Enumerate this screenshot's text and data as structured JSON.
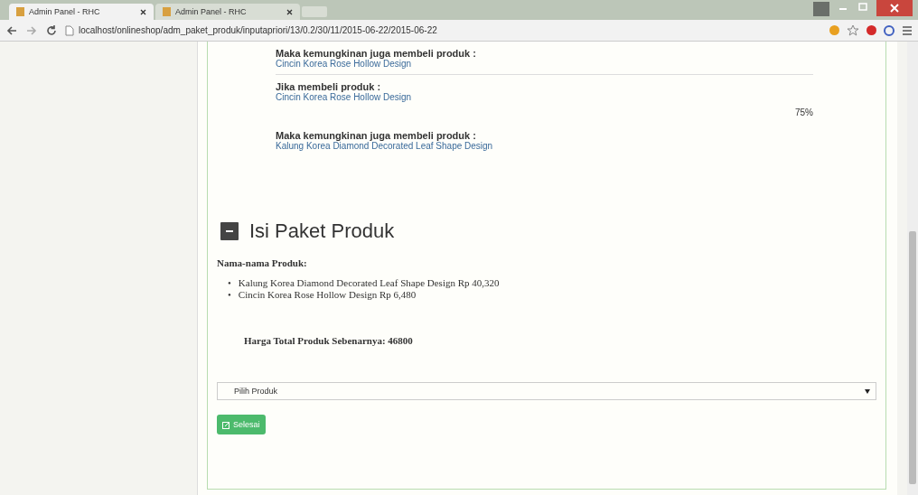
{
  "browser": {
    "tabs": [
      {
        "title": "Admin Panel - RHC",
        "selected": true
      },
      {
        "title": "Admin Panel - RHC",
        "selected": false
      }
    ],
    "url": "localhost/onlineshop/adm_paket_produk/inputapriori/13/0.2/30/11/2015-06-22/2015-06-22"
  },
  "rules": [
    {
      "items": [
        {
          "kind": "label",
          "text": "Maka kemungkinan juga membeli produk :"
        },
        {
          "kind": "product",
          "text": "Cincin Korea Rose Hollow Design"
        }
      ]
    },
    {
      "items": [
        {
          "kind": "label",
          "text": "Jika membeli produk :"
        },
        {
          "kind": "product",
          "text": "Cincin Korea Rose Hollow Design"
        },
        {
          "kind": "percent",
          "text": "75%"
        },
        {
          "kind": "label",
          "text": "Maka kemungkinan juga membeli produk :"
        },
        {
          "kind": "product",
          "text": "Kalung Korea Diamond Decorated Leaf Shape Design"
        }
      ]
    }
  ],
  "package": {
    "title": "Isi Paket Produk",
    "list_heading": "Nama-nama Produk:",
    "products": [
      {
        "marker": "•",
        "text": "Kalung Korea Diamond Decorated Leaf Shape Design Rp 40,320"
      },
      {
        "marker": "•",
        "text": "Cincin Korea Rose Hollow Design Rp 6,480"
      }
    ],
    "total": "Harga Total Produk Sebenarnya: 46800",
    "select": {
      "placeholder": "Pilih Produk"
    },
    "button": "Selesai"
  }
}
